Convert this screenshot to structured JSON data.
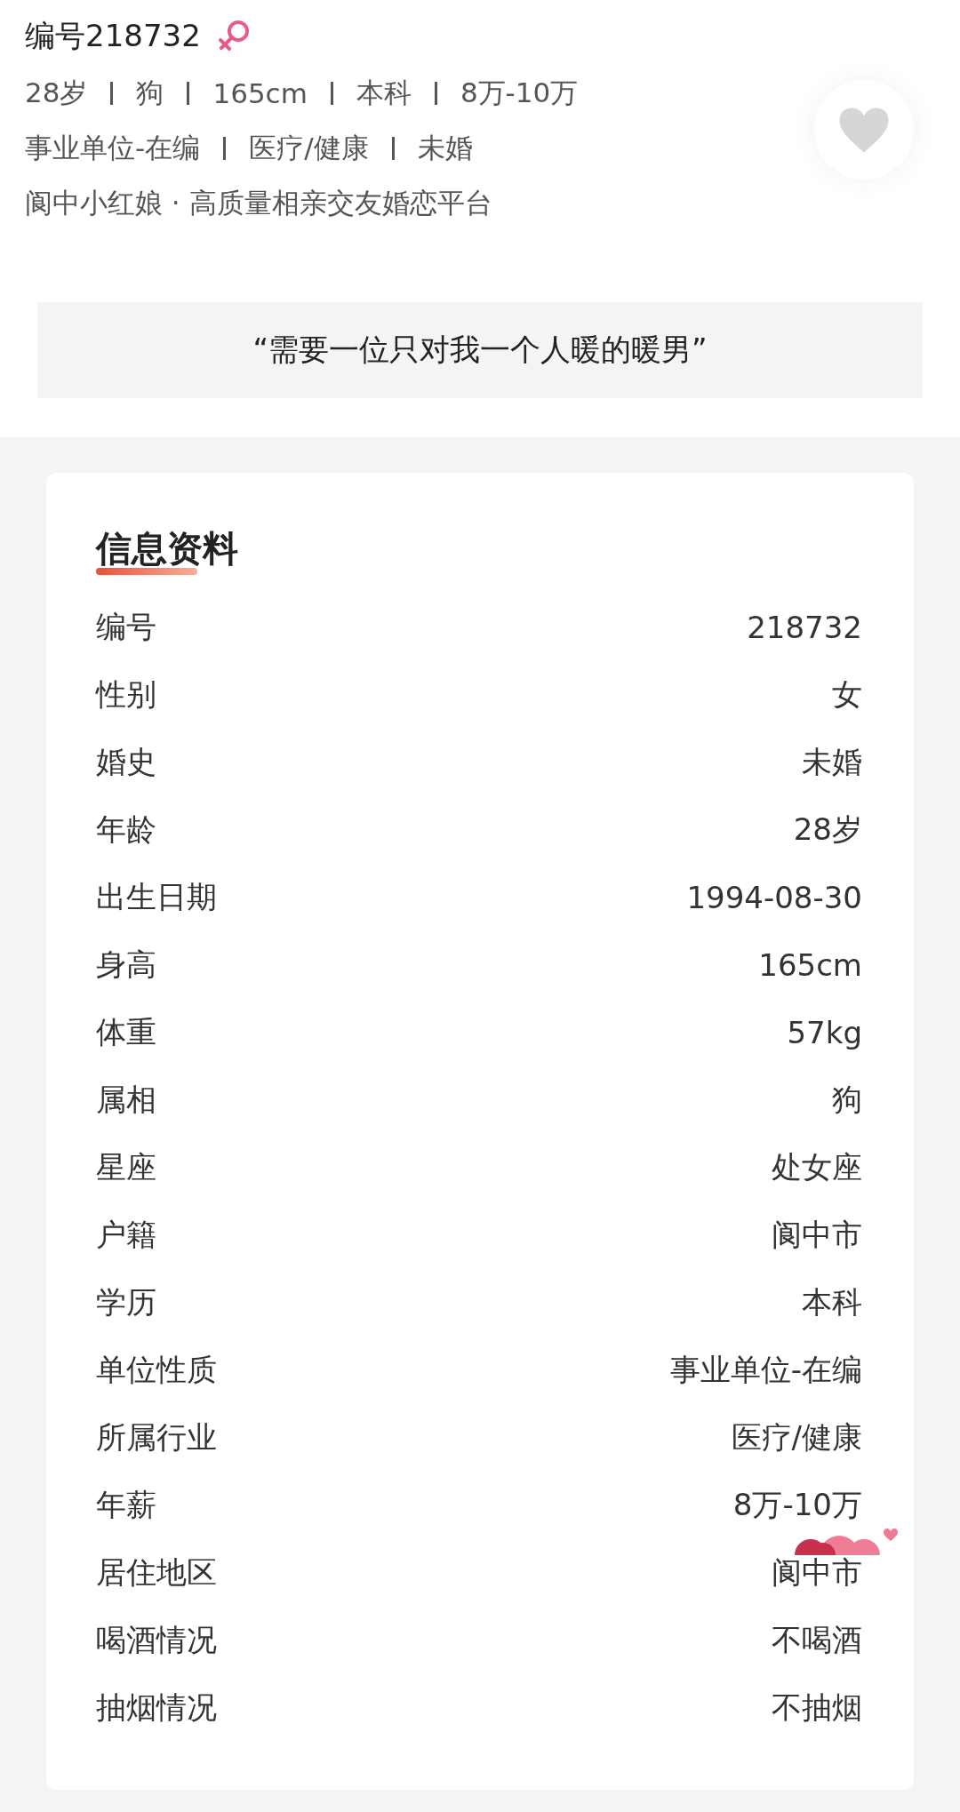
{
  "profile": {
    "title": "编号218732",
    "gender_icon": {
      "kind": "female"
    },
    "favorited": false,
    "tag_lines": [
      [
        "28岁",
        "狗",
        "165cm",
        "本科",
        "8万-10万"
      ],
      [
        "事业单位-在编",
        "医疗/健康",
        "未婚"
      ]
    ],
    "platform": "阆中小红娘 · 高质量相亲交友婚恋平台",
    "motto": "“需要一位只对我一个人暖的暖男”"
  },
  "info": {
    "heading": "信息资料",
    "rows": [
      {
        "label": "编号",
        "value": "218732"
      },
      {
        "label": "性别",
        "value": "女"
      },
      {
        "label": "婚史",
        "value": "未婚"
      },
      {
        "label": "年龄",
        "value": "28岁"
      },
      {
        "label": "出生日期",
        "value": "1994-08-30"
      },
      {
        "label": "身高",
        "value": "165cm"
      },
      {
        "label": "体重",
        "value": "57kg"
      },
      {
        "label": "属相",
        "value": "狗"
      },
      {
        "label": "星座",
        "value": "处女座"
      },
      {
        "label": "户籍",
        "value": "阆中市"
      },
      {
        "label": "学历",
        "value": "本科"
      },
      {
        "label": "单位性质",
        "value": "事业单位-在编"
      },
      {
        "label": "所属行业",
        "value": "医疗/健康"
      },
      {
        "label": "年薪",
        "value": "8万-10万"
      },
      {
        "label": "居住地区",
        "value": "阆中市"
      },
      {
        "label": "喝酒情况",
        "value": "不喝酒"
      },
      {
        "label": "抽烟情况",
        "value": "不抽烟"
      }
    ]
  }
}
